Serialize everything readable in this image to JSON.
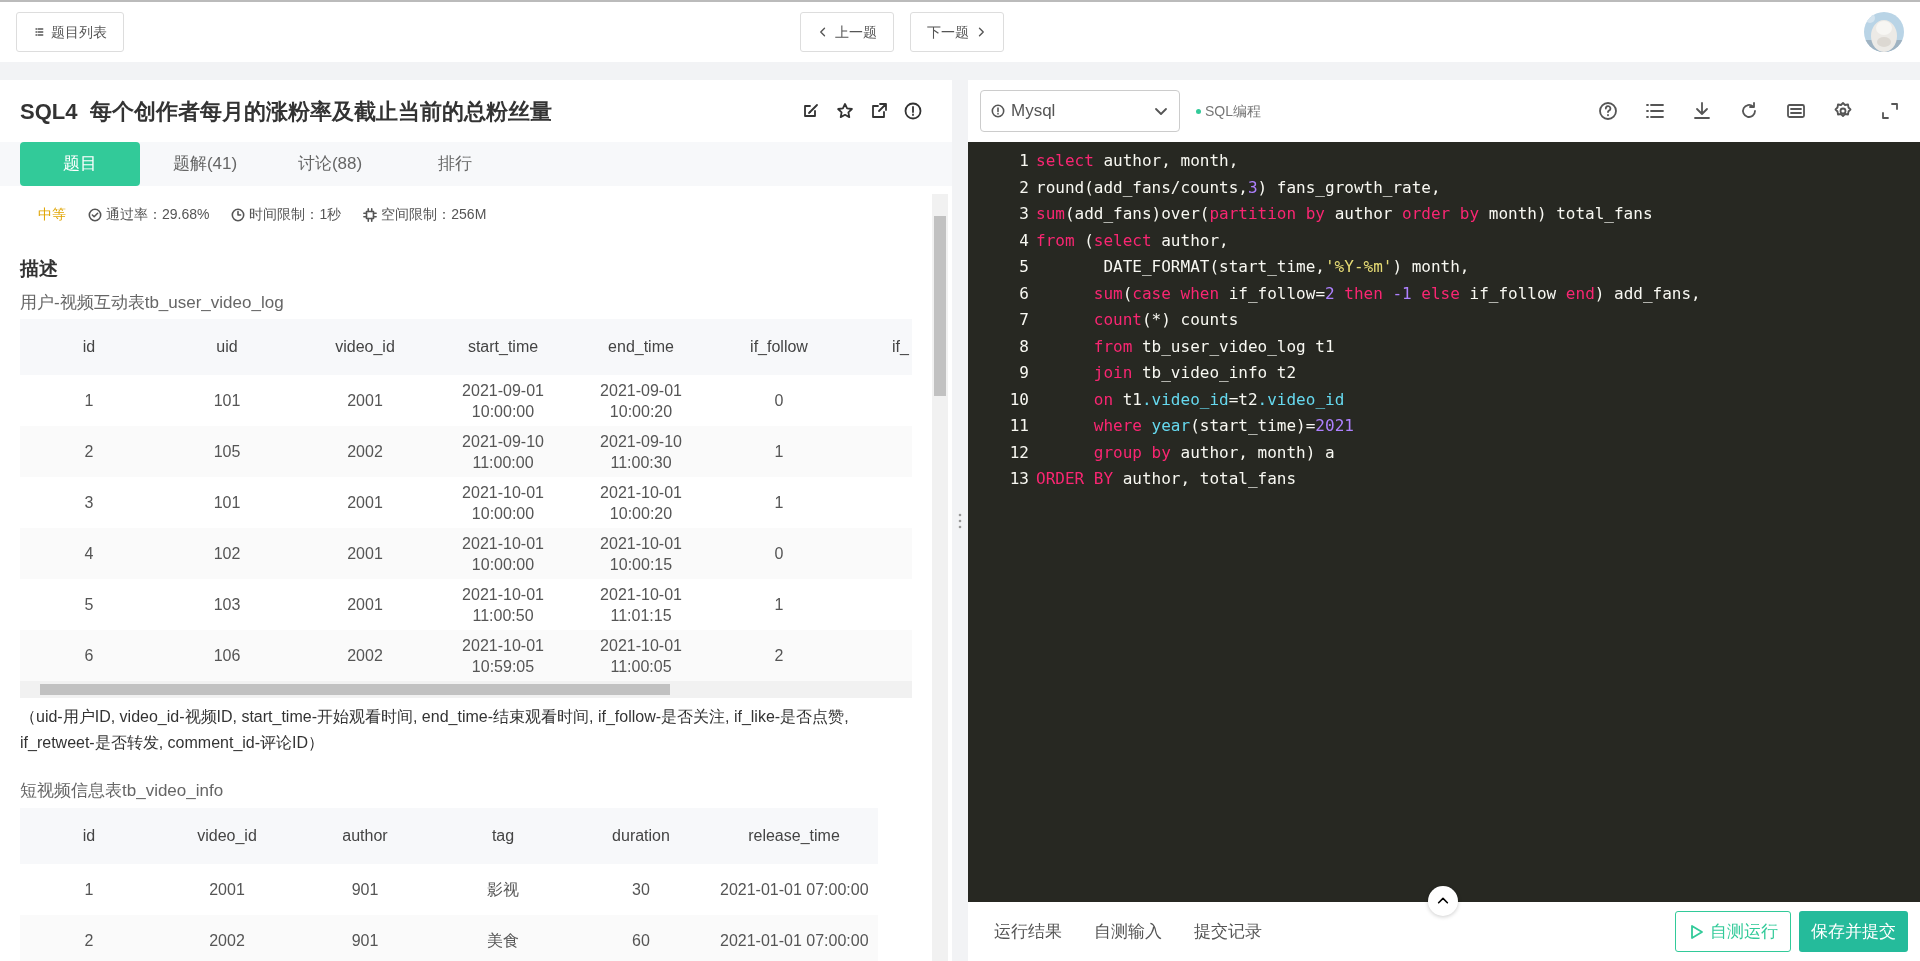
{
  "topbar": {
    "list_button": "题目列表",
    "prev_button": "上一题",
    "next_button": "下一题"
  },
  "problem": {
    "title": "SQL4  每个创作者每月的涨粉率及截止当前的总粉丝量",
    "tabs": [
      {
        "label": "题目",
        "selected": true
      },
      {
        "label": "题解(41)",
        "selected": false
      },
      {
        "label": "讨论(88)",
        "selected": false
      },
      {
        "label": "排行",
        "selected": false
      }
    ],
    "meta": {
      "difficulty": "中等",
      "pass_rate": "通过率：29.68%",
      "time_limit": "时间限制：1秒",
      "memory_limit": "空间限制：256M"
    },
    "description_heading": "描述",
    "blocks": [
      {
        "kind": "caption",
        "text": "用户-视频互动表tb_user_video_log"
      },
      {
        "kind": "table",
        "columns": [
          "id",
          "uid",
          "video_id",
          "start_time",
          "end_time",
          "if_follow",
          "if_"
        ],
        "rows": [
          [
            "1",
            "101",
            "2001",
            "2021-09-01 10:00:00",
            "2021-09-01 10:00:20",
            "0"
          ],
          [
            "2",
            "105",
            "2002",
            "2021-09-10 11:00:00",
            "2021-09-10 11:00:30",
            "1"
          ],
          [
            "3",
            "101",
            "2001",
            "2021-10-01 10:00:00",
            "2021-10-01 10:00:20",
            "1"
          ],
          [
            "4",
            "102",
            "2001",
            "2021-10-01 10:00:00",
            "2021-10-01 10:00:15",
            "0"
          ],
          [
            "5",
            "103",
            "2001",
            "2021-10-01 11:00:50",
            "2021-10-01 11:01:15",
            "1"
          ],
          [
            "6",
            "106",
            "2002",
            "2021-10-01 10:59:05",
            "2021-10-01 11:00:05",
            "2"
          ]
        ],
        "scrollable": true
      },
      {
        "kind": "note",
        "text": "（uid-用户ID, video_id-视频ID, start_time-开始观看时间, end_time-结束观看时间, if_follow-是否关注, if_like-是否点赞, if_retweet-是否转发, comment_id-评论ID）"
      },
      {
        "kind": "caption",
        "text": "短视频信息表tb_video_info"
      },
      {
        "kind": "table",
        "columns": [
          "id",
          "video_id",
          "author",
          "tag",
          "duration",
          "release_time"
        ],
        "rows": [
          [
            "1",
            "2001",
            "901",
            "影视",
            "30",
            "2021-01-01 07:00:00"
          ],
          [
            "2",
            "2002",
            "901",
            "美食",
            "60",
            "2021-01-01 07:00:00"
          ]
        ]
      }
    ]
  },
  "editor": {
    "language": "Mysql",
    "mode": "SQL编程",
    "code": [
      [
        {
          "t": "select",
          "kind": "kw"
        },
        {
          "t": " author, month,",
          "kind": "plain"
        }
      ],
      [
        {
          "t": "round(add_fans/counts,",
          "kind": "plain"
        },
        {
          "t": "3",
          "kind": "num"
        },
        {
          "t": ") fans_growth_rate,",
          "kind": "plain"
        }
      ],
      [
        {
          "t": "sum",
          "kind": "kw"
        },
        {
          "t": "(add_fans)over(",
          "kind": "plain"
        },
        {
          "t": "partition by",
          "kind": "kw"
        },
        {
          "t": " author ",
          "kind": "plain"
        },
        {
          "t": "order by",
          "kind": "kw"
        },
        {
          "t": " month) total_fans",
          "kind": "plain"
        }
      ],
      [
        {
          "t": "from",
          "kind": "kw"
        },
        {
          "t": " (",
          "kind": "plain"
        },
        {
          "t": "select",
          "kind": "kw"
        },
        {
          "t": " author,",
          "kind": "plain"
        }
      ],
      [
        {
          "t": "       DATE_FORMAT(start_time,",
          "kind": "plain"
        },
        {
          "t": "'%Y-%m'",
          "kind": "str"
        },
        {
          "t": ") month,",
          "kind": "plain"
        }
      ],
      [
        {
          "t": "      sum",
          "kind": "kw"
        },
        {
          "t": "(",
          "kind": "plain"
        },
        {
          "t": "case when",
          "kind": "kw"
        },
        {
          "t": " if_follow=",
          "kind": "plain"
        },
        {
          "t": "2",
          "kind": "num"
        },
        {
          "t": " then ",
          "kind": "kw"
        },
        {
          "t": "-1",
          "kind": "num"
        },
        {
          "t": " else",
          "kind": "kw"
        },
        {
          "t": " if_follow ",
          "kind": "plain"
        },
        {
          "t": "end",
          "kind": "kw"
        },
        {
          "t": ") add_fans,",
          "kind": "plain"
        }
      ],
      [
        {
          "t": "      count",
          "kind": "kw"
        },
        {
          "t": "(*) counts",
          "kind": "plain"
        }
      ],
      [
        {
          "t": "      from",
          "kind": "kw"
        },
        {
          "t": " tb_user_video_log t1",
          "kind": "plain"
        }
      ],
      [
        {
          "t": "      join",
          "kind": "kw"
        },
        {
          "t": " tb_video_info t2",
          "kind": "plain"
        }
      ],
      [
        {
          "t": "      on",
          "kind": "kw"
        },
        {
          "t": " t1",
          "kind": "plain"
        },
        {
          "t": ".video_id",
          "kind": "fn"
        },
        {
          "t": "=t2",
          "kind": "plain"
        },
        {
          "t": ".video_id",
          "kind": "fn"
        }
      ],
      [
        {
          "t": "      where ",
          "kind": "kw"
        },
        {
          "t": "year",
          "kind": "fn"
        },
        {
          "t": "(start_time)=",
          "kind": "plain"
        },
        {
          "t": "2021",
          "kind": "num"
        }
      ],
      [
        {
          "t": "      group by",
          "kind": "kw"
        },
        {
          "t": " author, month) a",
          "kind": "plain"
        }
      ],
      [
        {
          "t": "ORDER BY",
          "kind": "kw"
        },
        {
          "t": " author, total_fans",
          "kind": "plain"
        }
      ]
    ],
    "line_numbers": [
      "1",
      "2",
      "3",
      "4",
      "5",
      "6",
      "7",
      "8",
      "9",
      "10",
      "11",
      "12",
      "13"
    ],
    "bottom_tabs": [
      "运行结果",
      "自测输入",
      "提交记录"
    ],
    "run_button": "自测运行",
    "submit_button": "保存并提交"
  }
}
